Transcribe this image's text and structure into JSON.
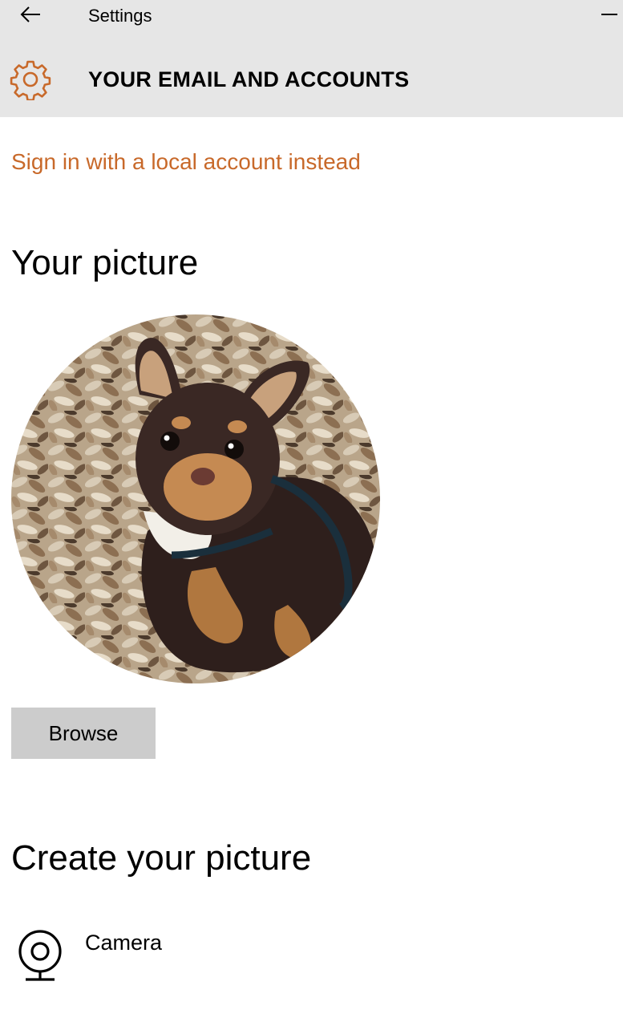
{
  "window": {
    "title": "Settings"
  },
  "header": {
    "page_title": "YOUR EMAIL AND ACCOUNTS",
    "icon": "gear-icon",
    "accent_color": "#c8692a"
  },
  "account": {
    "local_account_link": "Sign in with a local account instead"
  },
  "your_picture": {
    "heading": "Your picture",
    "avatar_subject": "chihuahua-photo",
    "browse_label": "Browse"
  },
  "create_picture": {
    "heading": "Create your picture",
    "options": [
      {
        "label": "Camera",
        "icon": "webcam-icon"
      }
    ]
  }
}
